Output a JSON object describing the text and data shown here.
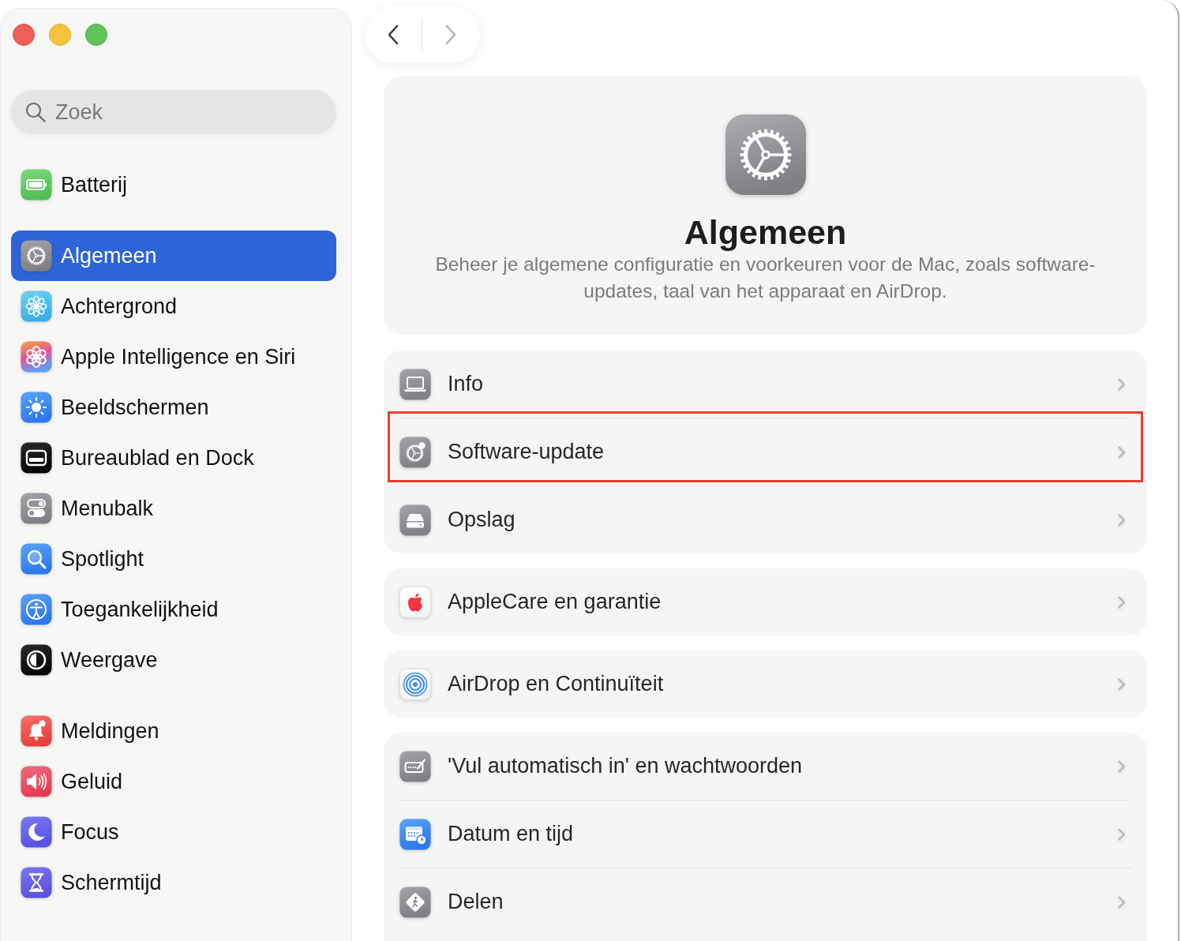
{
  "navigation": {
    "back": {
      "disabled": false
    },
    "forward": {
      "disabled": true
    }
  },
  "sidebar": {
    "search": {
      "placeholder": "Zoek"
    },
    "groups": [
      {
        "items": [
          {
            "label": "Batterij",
            "selected": false
          }
        ]
      },
      {
        "items": [
          {
            "label": "Algemeen",
            "selected": true
          },
          {
            "label": "Achtergrond",
            "selected": false
          },
          {
            "label": "Apple Intelligence en Siri",
            "selected": false
          },
          {
            "label": "Beeldschermen",
            "selected": false
          },
          {
            "label": "Bureaublad en Dock",
            "selected": false
          },
          {
            "label": "Menubalk",
            "selected": false
          },
          {
            "label": "Spotlight",
            "selected": false
          },
          {
            "label": "Toegankelijkheid",
            "selected": false
          },
          {
            "label": "Weergave",
            "selected": false
          }
        ]
      },
      {
        "items": [
          {
            "label": "Meldingen",
            "selected": false
          },
          {
            "label": "Geluid",
            "selected": false
          },
          {
            "label": "Focus",
            "selected": false
          },
          {
            "label": "Schermtijd",
            "selected": false
          }
        ]
      }
    ]
  },
  "header": {
    "title": "Algemeen",
    "description": "Beheer je algemene configuratie en voorkeuren voor de Mac, zoals software-updates, taal van het apparaat en AirDrop."
  },
  "groups": [
    {
      "rows": [
        {
          "label": "Info",
          "highlighted": false
        },
        {
          "label": "Software-update",
          "highlighted": true
        },
        {
          "label": "Opslag",
          "highlighted": false
        }
      ]
    },
    {
      "rows": [
        {
          "label": "AppleCare en garantie",
          "highlighted": false
        }
      ]
    },
    {
      "rows": [
        {
          "label": "AirDrop en Continuïteit",
          "highlighted": false
        }
      ]
    },
    {
      "rows": [
        {
          "label": "'Vul automatisch in' en wachtwoorden",
          "highlighted": false
        },
        {
          "label": "Datum en tijd",
          "highlighted": false
        },
        {
          "label": "Delen",
          "highlighted": false
        }
      ]
    }
  ]
}
